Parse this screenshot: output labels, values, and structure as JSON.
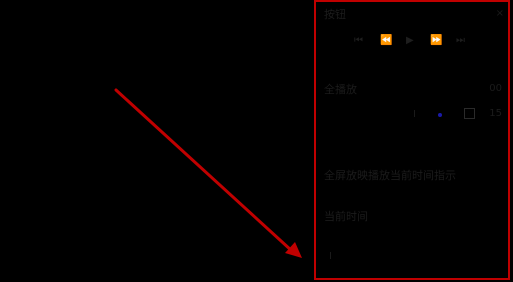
{
  "panel": {
    "title": "按钮",
    "close_glyph": "×",
    "toolbar": [
      "⏮",
      "⏪",
      "▶",
      "⏩",
      "⏭"
    ],
    "section_one_label": "全播放",
    "section_one_value": "00",
    "option_value": "15",
    "section_two_label": "全屏放映播放当前时间指示",
    "section_three_label": "当前时间"
  },
  "colors": {
    "border": "#c00000",
    "arrow": "#c00000",
    "dot_blue": "#1a1aa8"
  }
}
